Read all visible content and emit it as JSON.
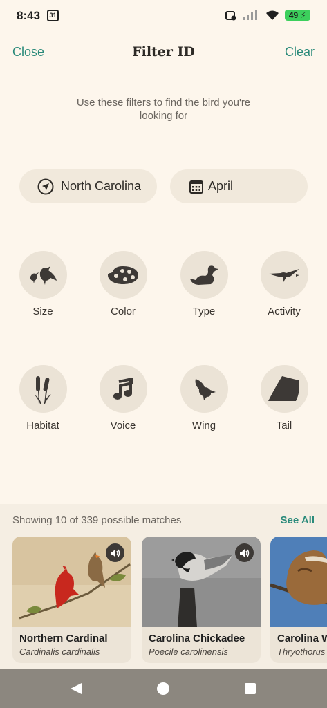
{
  "status_bar": {
    "time": "8:43",
    "calendar_day": "31",
    "battery": "49"
  },
  "header": {
    "close_label": "Close",
    "title": "Filter ID",
    "clear_label": "Clear"
  },
  "subtitle": "Use these filters to find the bird you're looking for",
  "location_pill": {
    "label": "North Carolina",
    "icon": "location-arrow-icon"
  },
  "date_pill": {
    "label": "April",
    "icon": "calendar-icon"
  },
  "filters": [
    {
      "label": "Size",
      "icon": "size-birds-icon"
    },
    {
      "label": "Color",
      "icon": "palette-icon"
    },
    {
      "label": "Type",
      "icon": "duck-icon"
    },
    {
      "label": "Activity",
      "icon": "flying-bird-icon"
    },
    {
      "label": "Habitat",
      "icon": "cattail-icon"
    },
    {
      "label": "Voice",
      "icon": "music-note-icon"
    },
    {
      "label": "Wing",
      "icon": "wing-bird-icon"
    },
    {
      "label": "Tail",
      "icon": "tail-icon"
    }
  ],
  "results": {
    "summary": "Showing 10 of 339 possible matches",
    "see_all_label": "See All",
    "birds": [
      {
        "name": "Northern Cardinal",
        "scientific_name": "Cardinalis cardinalis"
      },
      {
        "name": "Carolina Chickadee",
        "scientific_name": "Poecile carolinensis"
      },
      {
        "name": "Carolina W",
        "scientific_name": "Thryothorus"
      }
    ]
  },
  "colors": {
    "background": "#fdf6ec",
    "accent": "#2a8a7a",
    "chip": "#f1e9dc",
    "filter_circle": "#ebe3d6",
    "nav_bar": "#8c877f"
  }
}
